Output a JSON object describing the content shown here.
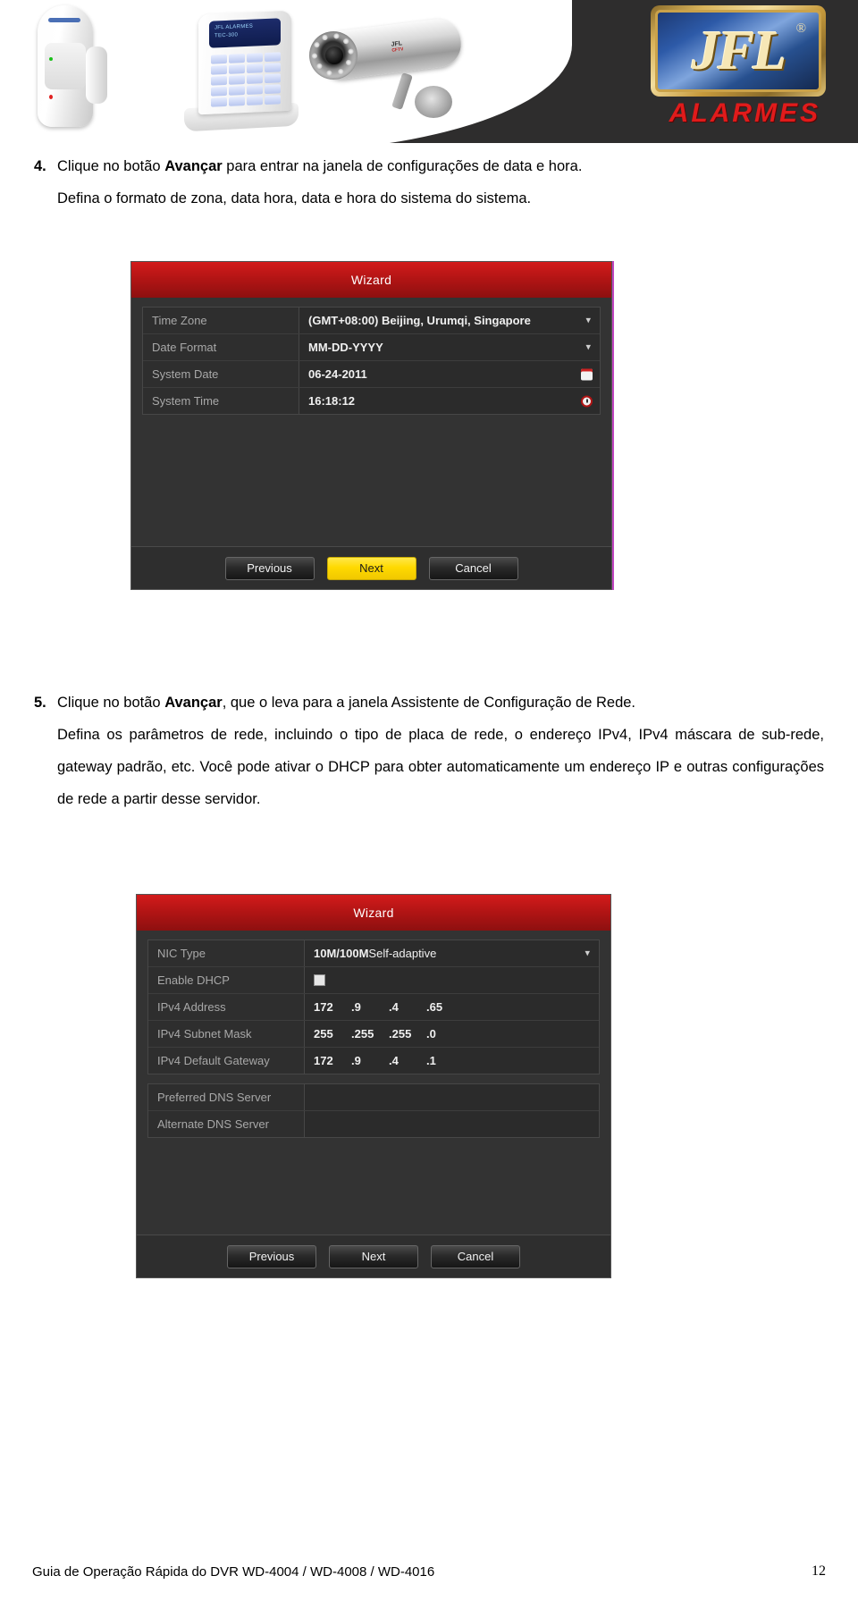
{
  "banner": {
    "brand_name": "JFL",
    "brand_tagline": "ALARMES",
    "registered_mark": "®",
    "keypad_screen_line1": "JFL ALARMES",
    "keypad_screen_line2": "TEC-300",
    "camera_brand": "JFL",
    "camera_sub": "CFTV",
    "products": [
      {
        "name": "pir-motion-sensor"
      },
      {
        "name": "alarm-keypad"
      },
      {
        "name": "bullet-ir-camera"
      }
    ]
  },
  "step4": {
    "number": "4.",
    "line1_pre": "Clique no botão ",
    "line1_bold": "Avançar",
    "line1_post": " para entrar na janela de configurações de data e hora.",
    "line2": "Defina o formato de zona, data hora, data e hora do sistema do sistema."
  },
  "step5": {
    "number": "5.",
    "line1_pre": "Clique no botão ",
    "line1_bold": "Avançar",
    "line1_post": ", que o leva para a janela Assistente de Configuração de Rede.",
    "paragraph": "Defina os parâmetros de rede, incluindo o tipo de placa de rede, o endereço IPv4, IPv4 máscara de sub-rede, gateway padrão, etc. Você pode ativar o DHCP para obter automaticamente um endereço IP e outras configurações de rede a partir desse servidor."
  },
  "wizard_datetime": {
    "title": "Wizard",
    "rows": [
      {
        "label": "Time Zone",
        "value": "(GMT+08:00) Beijing, Urumqi, Singapore",
        "control": "dropdown"
      },
      {
        "label": "Date Format",
        "value": "MM-DD-YYYY",
        "control": "dropdown"
      },
      {
        "label": "System Date",
        "value": "06-24-2011",
        "control": "calendar"
      },
      {
        "label": "System Time",
        "value": "16:18:12",
        "control": "clock"
      }
    ],
    "buttons": {
      "previous": "Previous",
      "next": "Next",
      "cancel": "Cancel"
    }
  },
  "wizard_network": {
    "title": "Wizard",
    "nic_type": {
      "label": "NIC Type",
      "value_bold": "10M/100M",
      "value_rest": " Self-adaptive",
      "control": "dropdown"
    },
    "enable_dhcp": {
      "label": "Enable DHCP",
      "checked": false
    },
    "ipv4_address": {
      "label": "IPv4 Address",
      "octets": [
        "172",
        ".9",
        ".4",
        ".65"
      ]
    },
    "ipv4_subnet_mask": {
      "label": "IPv4 Subnet Mask",
      "octets": [
        "255",
        ".255",
        ".255",
        ".0"
      ]
    },
    "ipv4_default_gateway": {
      "label": "IPv4 Default Gateway",
      "octets": [
        "172",
        ".9",
        ".4",
        ".1"
      ]
    },
    "preferred_dns": {
      "label": "Preferred DNS Server",
      "value": ""
    },
    "alternate_dns": {
      "label": "Alternate DNS Server",
      "value": ""
    },
    "buttons": {
      "previous": "Previous",
      "next": "Next",
      "cancel": "Cancel"
    }
  },
  "footer": {
    "text": "Guia de Operação Rápida do DVR WD-4004 / WD-4008 / WD-4016",
    "page": "12"
  },
  "colors": {
    "brand_red": "#e01b1b",
    "dialog_title_red": "#b01414",
    "primary_button_yellow": "#ffd900",
    "banner_dark": "#2e2d2d",
    "gold": "#caa24a"
  }
}
